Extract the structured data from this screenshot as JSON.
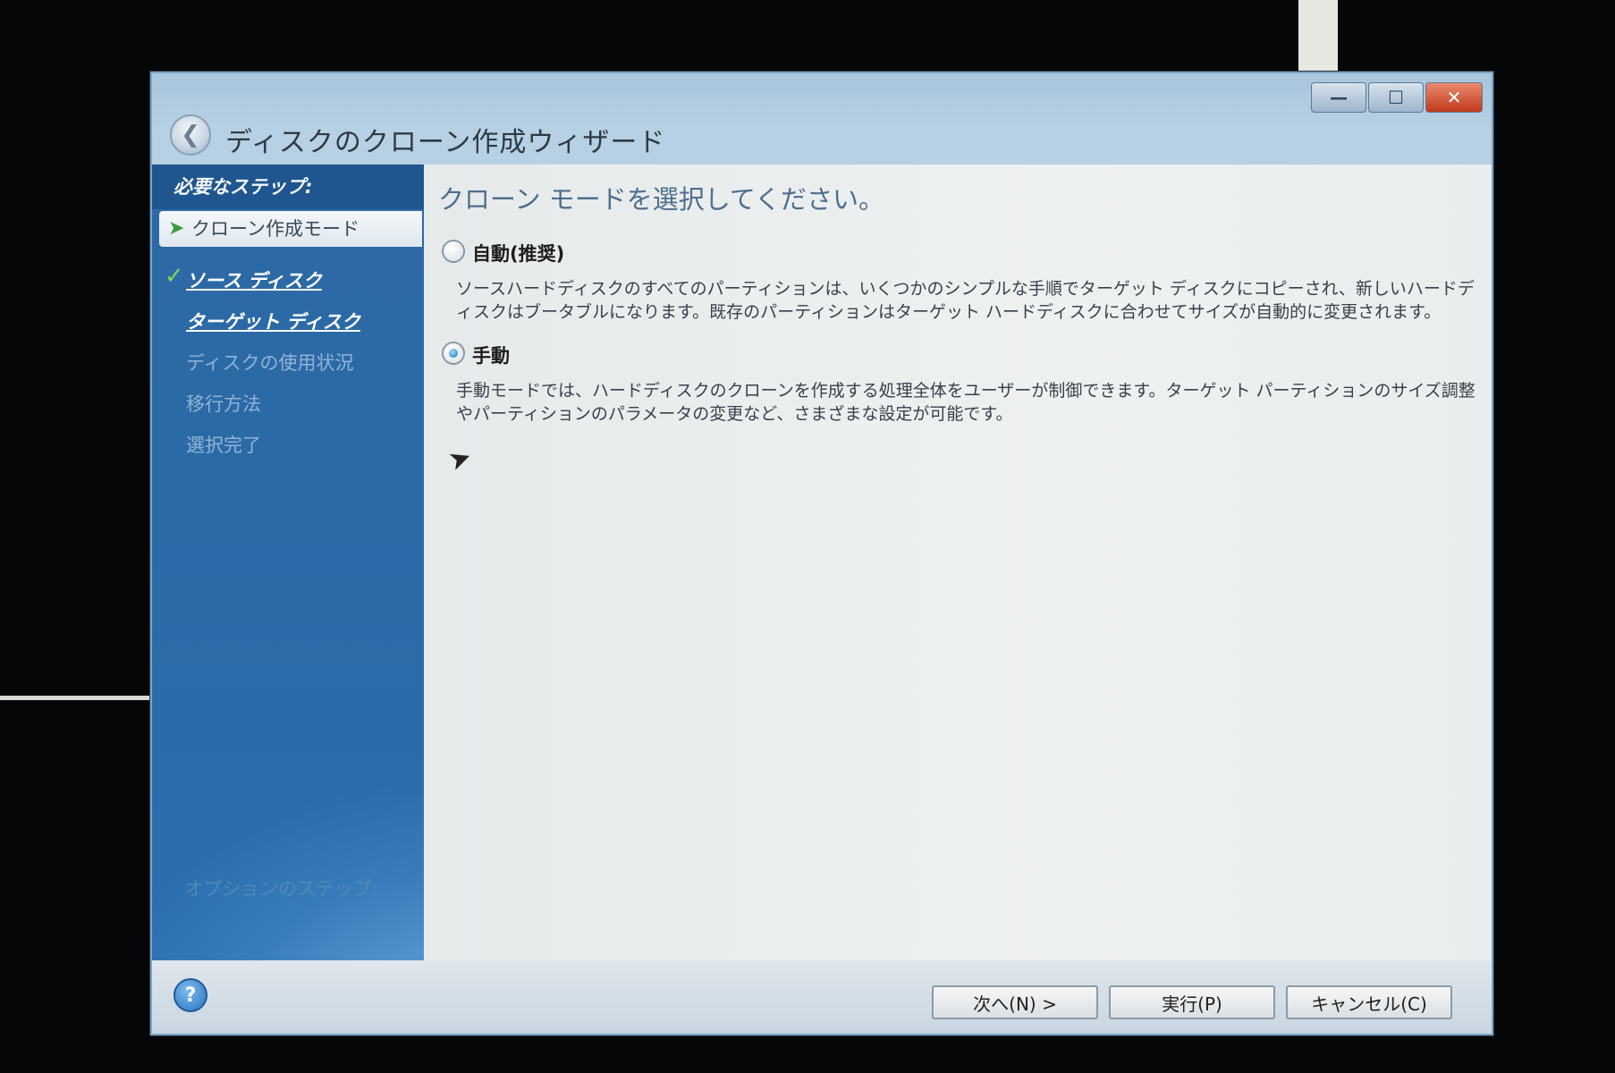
{
  "window": {
    "title": "ディスクのクローン作成ウィザード",
    "controls": {
      "minimize": "—",
      "maximize": "☐",
      "close": "✕"
    }
  },
  "sidebar": {
    "header": "必要なステップ:",
    "active_step": "クローン作成モード",
    "items": [
      {
        "label": "ソース ディスク",
        "state": "done"
      },
      {
        "label": "ターゲット ディスク",
        "state": "link"
      },
      {
        "label": "ディスクの使用状況",
        "state": "disabled"
      },
      {
        "label": "移行方法",
        "state": "disabled"
      },
      {
        "label": "選択完了",
        "state": "disabled"
      }
    ],
    "optional_header": "オプションのステップ:"
  },
  "content": {
    "heading": "クローン モードを選択してください。",
    "options": [
      {
        "label": "自動(推奨)",
        "checked": false,
        "description": "ソースハードディスクのすべてのパーティションは、いくつかのシンプルな手順でターゲット ディスクにコピーされ、新しいハードディスクはブータブルになります。既存のパーティションはターゲット ハードディスクに合わせてサイズが自動的に変更されます。"
      },
      {
        "label": "手動",
        "checked": true,
        "description": "手動モードでは、ハードディスクのクローンを作成する処理全体をユーザーが制御できます。ターゲット パーティションのサイズ調整やパーティションのパラメータの変更など、さまざまな設定が可能です。"
      }
    ]
  },
  "footer": {
    "help_icon": "?",
    "next_label": "次へ(N) >",
    "execute_label": "実行(P)",
    "cancel_label": "キャンセル(C)"
  },
  "icons": {
    "back": "back-arrow-icon",
    "active_arrow": "green-arrow-icon",
    "check": "green-check-icon",
    "help": "help-icon"
  }
}
